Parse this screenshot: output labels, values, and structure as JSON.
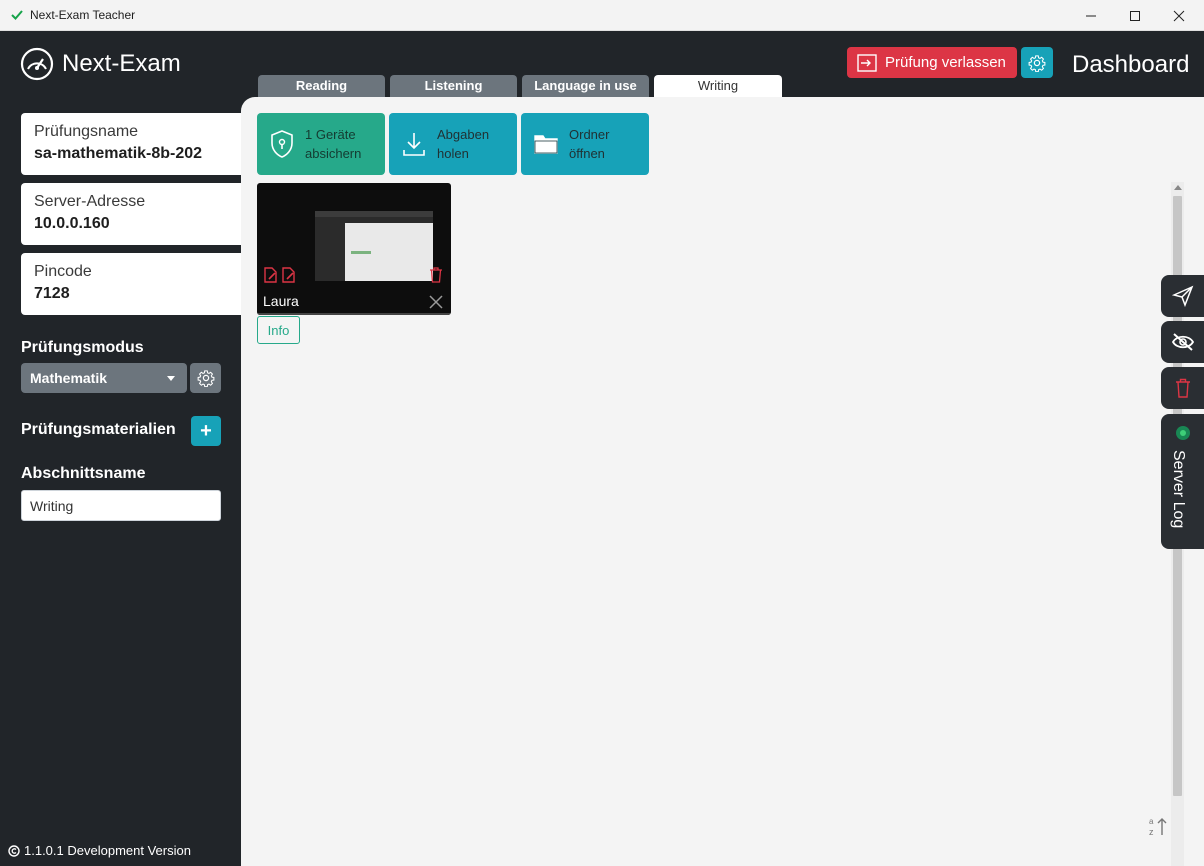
{
  "window": {
    "title": "Next-Exam Teacher",
    "minimize": "—",
    "maximize": "☐",
    "close": "✕"
  },
  "brand": {
    "name": "Next-Exam"
  },
  "header": {
    "leave_label": "Prüfung verlassen",
    "title": "Dashboard"
  },
  "sidebar": {
    "exam_name_label": "Prüfungsname",
    "exam_name_value": "sa-mathematik-8b-202",
    "server_label": "Server-Adresse",
    "server_value": "10.0.0.160",
    "pincode_label": "Pincode",
    "pincode_value": "7128",
    "mode_heading": "Prüfungsmodus",
    "mode_selected": "Mathematik",
    "materials_heading": "Prüfungsmaterialien",
    "materials_add": "+",
    "section_heading": "Abschnittsname",
    "section_value": "Writing",
    "version": "1.1.0.1 Development Version"
  },
  "tabs": [
    {
      "label": "Reading"
    },
    {
      "label": "Listening"
    },
    {
      "label": "Language in use"
    },
    {
      "label": "Writing",
      "active": true
    }
  ],
  "actions": {
    "secure_line1": "1 Geräte",
    "secure_line2": "absichern",
    "fetch_line1": "Abgaben",
    "fetch_line2": "holen",
    "folder_line1": "Ordner",
    "folder_line2": "öffnen"
  },
  "students": [
    {
      "name": "Laura",
      "info_label": "Info"
    }
  ],
  "right_panel": {
    "server_log_label": "Server Log"
  },
  "colors": {
    "accent_teal": "#17a2b8",
    "success_green": "#26a98a",
    "danger_red": "#dc3545",
    "dark_bg": "#212529"
  }
}
